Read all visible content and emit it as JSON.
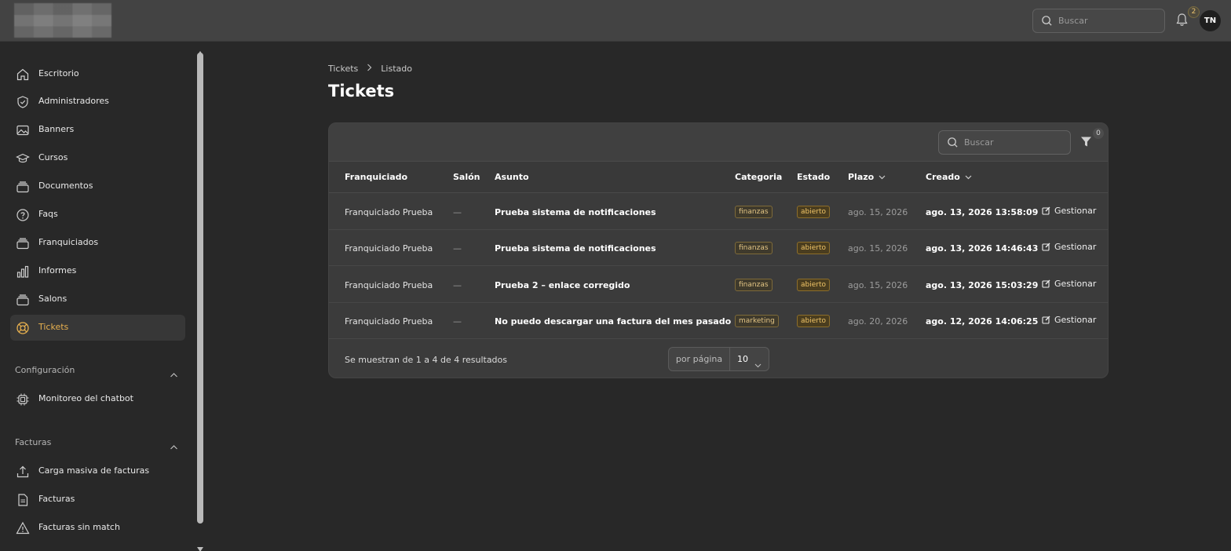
{
  "header": {
    "search_placeholder": "Buscar",
    "notifications_count": "2",
    "avatar_initials": "TN"
  },
  "sidebar": {
    "items": [
      {
        "label": "Escritorio",
        "icon": "home-icon"
      },
      {
        "label": "Administradores",
        "icon": "shield-check-icon"
      },
      {
        "label": "Banners",
        "icon": "image-icon"
      },
      {
        "label": "Cursos",
        "icon": "graduation-cap-icon"
      },
      {
        "label": "Documentos",
        "icon": "folder-stack-icon"
      },
      {
        "label": "Faqs",
        "icon": "question-circle-icon"
      },
      {
        "label": "Franquiciados",
        "icon": "folder-stack-icon"
      },
      {
        "label": "Informes",
        "icon": "bar-chart-icon"
      },
      {
        "label": "Salons",
        "icon": "folder-stack-icon"
      },
      {
        "label": "Tickets",
        "icon": "lifebuoy-icon",
        "active": true
      }
    ],
    "sections": [
      {
        "title": "Configuración",
        "items": [
          {
            "label": "Monitoreo del chatbot",
            "icon": "cpu-chip-icon"
          }
        ]
      },
      {
        "title": "Facturas",
        "items": [
          {
            "label": "Carga masiva de facturas",
            "icon": "upload-icon"
          },
          {
            "label": "Facturas",
            "icon": "document-icon"
          },
          {
            "label": "Facturas sin match",
            "icon": "warning-triangle-icon"
          }
        ]
      }
    ],
    "active_color": "#e7b04f"
  },
  "breadcrumb": {
    "items": [
      "Tickets",
      "Listado"
    ]
  },
  "page": {
    "title": "Tickets"
  },
  "table": {
    "search_placeholder": "Buscar",
    "filter_count": "0",
    "columns": [
      "Franquiciado",
      "Salón",
      "Asunto",
      "Categoria",
      "Estado",
      "Plazo",
      "Creado"
    ],
    "rows": [
      {
        "franquiciado": "Franquiciado Prueba",
        "salon": "—",
        "asunto": "Prueba sistema de notificaciones",
        "categoria": "finanzas",
        "estado": "abierto",
        "plazo": "ago. 15, 2026",
        "creado": "ago. 13, 2026 13:58:09",
        "action": "Gestionar"
      },
      {
        "franquiciado": "Franquiciado Prueba",
        "salon": "—",
        "asunto": "Prueba sistema de notificaciones",
        "categoria": "finanzas",
        "estado": "abierto",
        "plazo": "ago. 15, 2026",
        "creado": "ago. 13, 2026 14:46:43",
        "action": "Gestionar"
      },
      {
        "franquiciado": "Franquiciado Prueba",
        "salon": "—",
        "asunto": "Prueba 2 – enlace corregido",
        "categoria": "finanzas",
        "estado": "abierto",
        "plazo": "ago. 15, 2026",
        "creado": "ago. 13, 2026 15:03:29",
        "action": "Gestionar"
      },
      {
        "franquiciado": "Franquiciado Prueba",
        "salon": "—",
        "asunto": "No puedo descargar una factura del mes pasado",
        "categoria": "marketing",
        "estado": "abierto",
        "plazo": "ago. 20, 2026",
        "creado": "ago. 12, 2026 14:06:25",
        "action": "Gestionar"
      }
    ],
    "footer": {
      "results_text": "Se muestran de 1 a 4 de 4 resultados",
      "per_page_label": "por página",
      "per_page_value": "10"
    }
  }
}
